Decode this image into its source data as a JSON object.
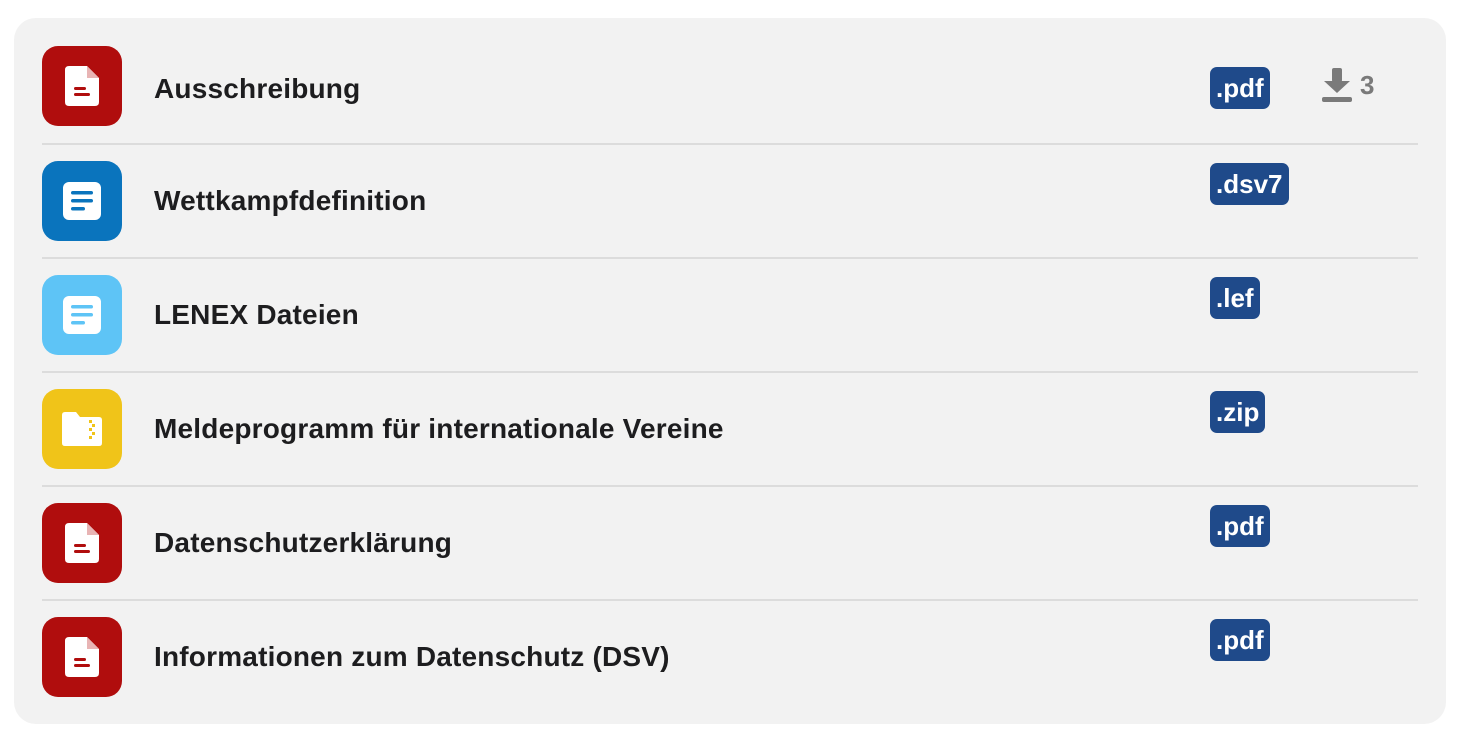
{
  "files": [
    {
      "name": "Ausschreibung",
      "ext": ".pdf",
      "type": "pdf",
      "icon": "pdf-file-icon",
      "color": "#b00d0d",
      "downloads": "3"
    },
    {
      "name": "Wettkampfdefinition",
      "ext": ".dsv7",
      "type": "text",
      "icon": "text-file-icon",
      "color": "#0a74bd"
    },
    {
      "name": "LENEX Dateien",
      "ext": ".lef",
      "type": "text",
      "icon": "text-file-icon",
      "color": "#5ec4f6"
    },
    {
      "name": "Meldeprogramm für internationale Vereine",
      "ext": ".zip",
      "type": "zip",
      "icon": "zip-folder-icon",
      "color": "#f0c419"
    },
    {
      "name": "Datenschutzerklärung",
      "ext": ".pdf",
      "type": "pdf",
      "icon": "pdf-file-icon",
      "color": "#b00d0d"
    },
    {
      "name": "Informationen zum Datenschutz (DSV)",
      "ext": ".pdf",
      "type": "pdf",
      "icon": "pdf-file-icon",
      "color": "#b00d0d"
    }
  ],
  "colors": {
    "badge": "#1f4a8a",
    "card_background": "#f2f2f2",
    "download_count": "#7a7a7a"
  }
}
